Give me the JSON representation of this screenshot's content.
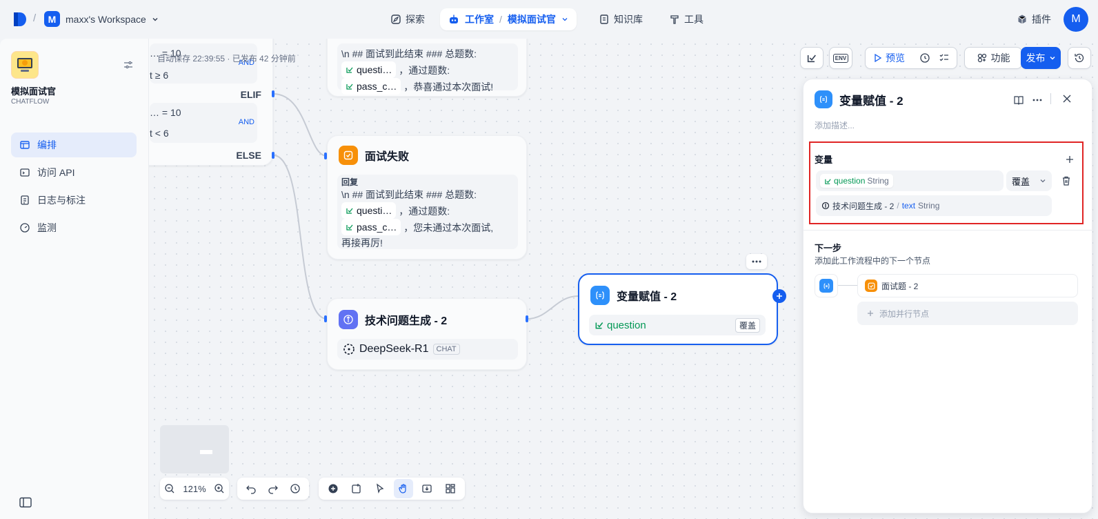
{
  "topbar": {
    "workspace_initial": "M",
    "workspace_name": "maxx's Workspace",
    "nav_explore": "探索",
    "nav_studio": "工作室",
    "nav_app": "模拟面试官",
    "nav_knowledge": "知识库",
    "nav_tools": "工具",
    "plugins": "插件",
    "avatar": "M"
  },
  "sidebar": {
    "app_name": "模拟面试官",
    "app_type": "CHATFLOW",
    "items": [
      {
        "label": "编排",
        "icon": "layout-icon"
      },
      {
        "label": "访问 API",
        "icon": "terminal-icon"
      },
      {
        "label": "日志与标注",
        "icon": "document-icon"
      },
      {
        "label": "监测",
        "icon": "gauge-icon"
      }
    ]
  },
  "toolbar": {
    "autosave": "自动保存 22:39:55 · 已发布 42 分钟前",
    "preview": "预览",
    "features": "功能",
    "publish": "发布",
    "env": "ENV"
  },
  "canvas": {
    "ifelse": {
      "cond1_left": "… = 10",
      "cond2_left": "t ≥ 6",
      "and1": "AND",
      "elif": "ELIF",
      "cond3_left": "… = 10",
      "cond4_left": "t < 6",
      "and2": "AND",
      "else": "ELSE"
    },
    "answer_pass": {
      "line1": "\\n ## 面试到此结束 ### 总题数:",
      "var1": "questi…",
      "text1": "，通过题数:",
      "var2": "pass_c…",
      "text2": "，恭喜通过本次面试!"
    },
    "answer_fail": {
      "title": "面试失败",
      "label": "回复",
      "line1": "\\n ## 面试到此结束 ### 总题数:",
      "var1": "questi…",
      "text1": "，通过题数:",
      "var2": "pass_c…",
      "text2": "，您未通过本次面试,",
      "text3": "再接再厉!"
    },
    "llm": {
      "title": "技术问题生成 - 2",
      "model": "DeepSeek-R1",
      "mode": "CHAT"
    },
    "assign": {
      "title": "变量赋值 - 2",
      "var": "question",
      "op": "覆盖"
    },
    "zoom": "121%"
  },
  "panel": {
    "title": "变量赋值 - 2",
    "desc_placeholder": "添加描述...",
    "var_section": "变量",
    "var_name": "question",
    "var_type": "String",
    "op": "覆盖",
    "source_node": "技术问题生成 - 2",
    "source_sep": "/",
    "source_var": "text",
    "source_type": "String",
    "next_title": "下一步",
    "next_desc": "添加此工作流程中的下一个节点",
    "next_node": "面试题 - 2",
    "add_parallel": "添加并行节点"
  },
  "colors": {
    "accent": "#155eef",
    "highlight": "#e02424",
    "answer": "#f79009",
    "llm": "#6172f3"
  }
}
